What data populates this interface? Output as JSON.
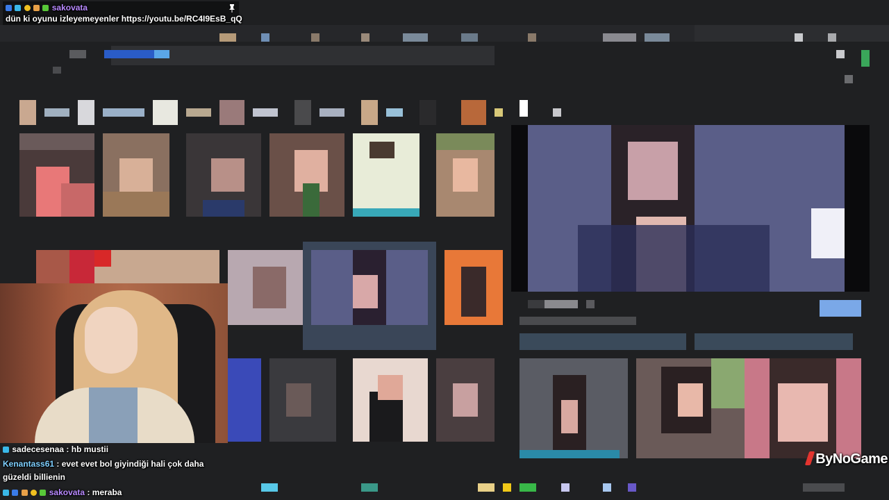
{
  "pinned_message": {
    "username": "sakovata",
    "text": "dün ki oyunu izleyemeyenler https://youtu.be/RC4I9EsB_qQ",
    "username_color": "#b889ff"
  },
  "chat": [
    {
      "username": "sadecesenaa",
      "separator": ":",
      "message": "hb mustii",
      "username_color": "#ffffff"
    },
    {
      "username": "Kenantass61",
      "separator": ":",
      "message": "evet evet bol giyindiği hali çok daha",
      "continuation": "güzeldi billienin",
      "username_color": "#7fd0ff"
    },
    {
      "username": "sakovata",
      "separator": ":",
      "message": "meraba",
      "username_color": "#b889ff"
    }
  ],
  "watermark": {
    "text": "ByNoGame",
    "accent_color": "#e3342f"
  },
  "icons": {
    "pin": "pin-icon",
    "badges": [
      "verified-badge-icon",
      "moderator-badge-icon",
      "subscriber-badge-icon",
      "gift-badge-icon"
    ]
  }
}
